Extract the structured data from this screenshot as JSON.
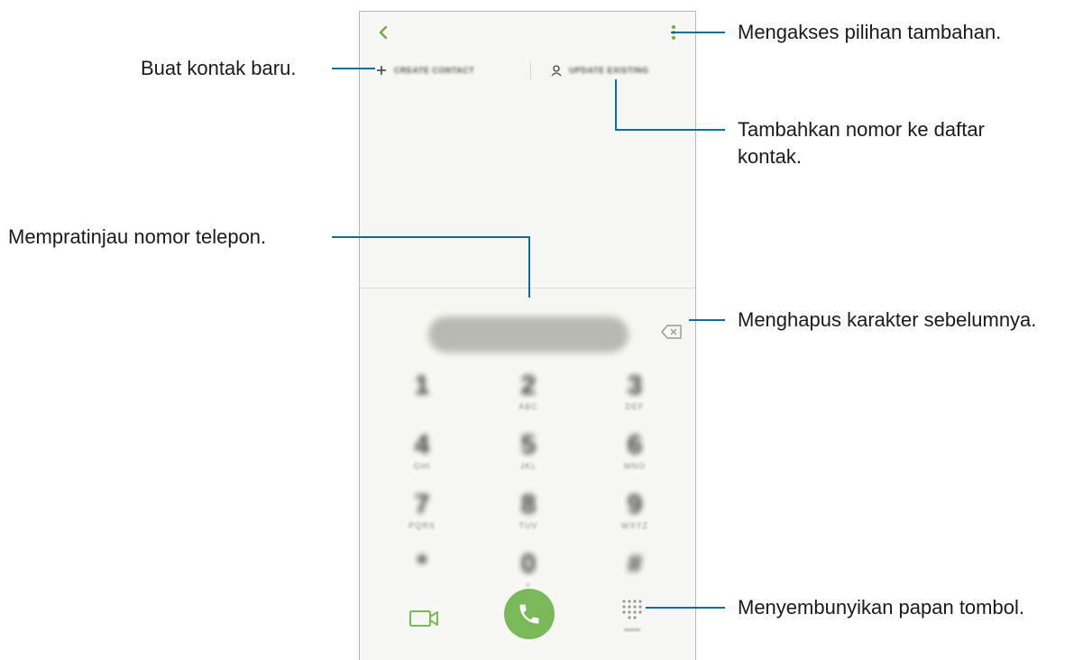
{
  "phone": {
    "create_contact_label": "CREATE CONTACT",
    "update_existing_label": "UPDATE EXISTING",
    "number_display": "0000000000",
    "keypad": [
      {
        "digit": "1",
        "sub": ""
      },
      {
        "digit": "2",
        "sub": "ABC"
      },
      {
        "digit": "3",
        "sub": "DEF"
      },
      {
        "digit": "4",
        "sub": "GHI"
      },
      {
        "digit": "5",
        "sub": "JKL"
      },
      {
        "digit": "6",
        "sub": "MNO"
      },
      {
        "digit": "7",
        "sub": "PQRS"
      },
      {
        "digit": "8",
        "sub": "TUV"
      },
      {
        "digit": "9",
        "sub": "WXYZ"
      },
      {
        "digit": "*",
        "sub": ""
      },
      {
        "digit": "0",
        "sub": "+"
      },
      {
        "digit": "#",
        "sub": ""
      }
    ],
    "accent_color": "#79b95a"
  },
  "callouts": {
    "more_options": "Mengakses pilihan tambahan.",
    "create_contact": "Buat kontak baru.",
    "add_to_contacts_line1": "Tambahkan nomor ke daftar",
    "add_to_contacts_line2": "kontak.",
    "preview_number": "Mempratinjau nomor telepon.",
    "delete_char": "Menghapus karakter sebelumnya.",
    "hide_keypad": "Menyembunyikan papan tombol."
  },
  "leader_color": "#0e6e9a"
}
